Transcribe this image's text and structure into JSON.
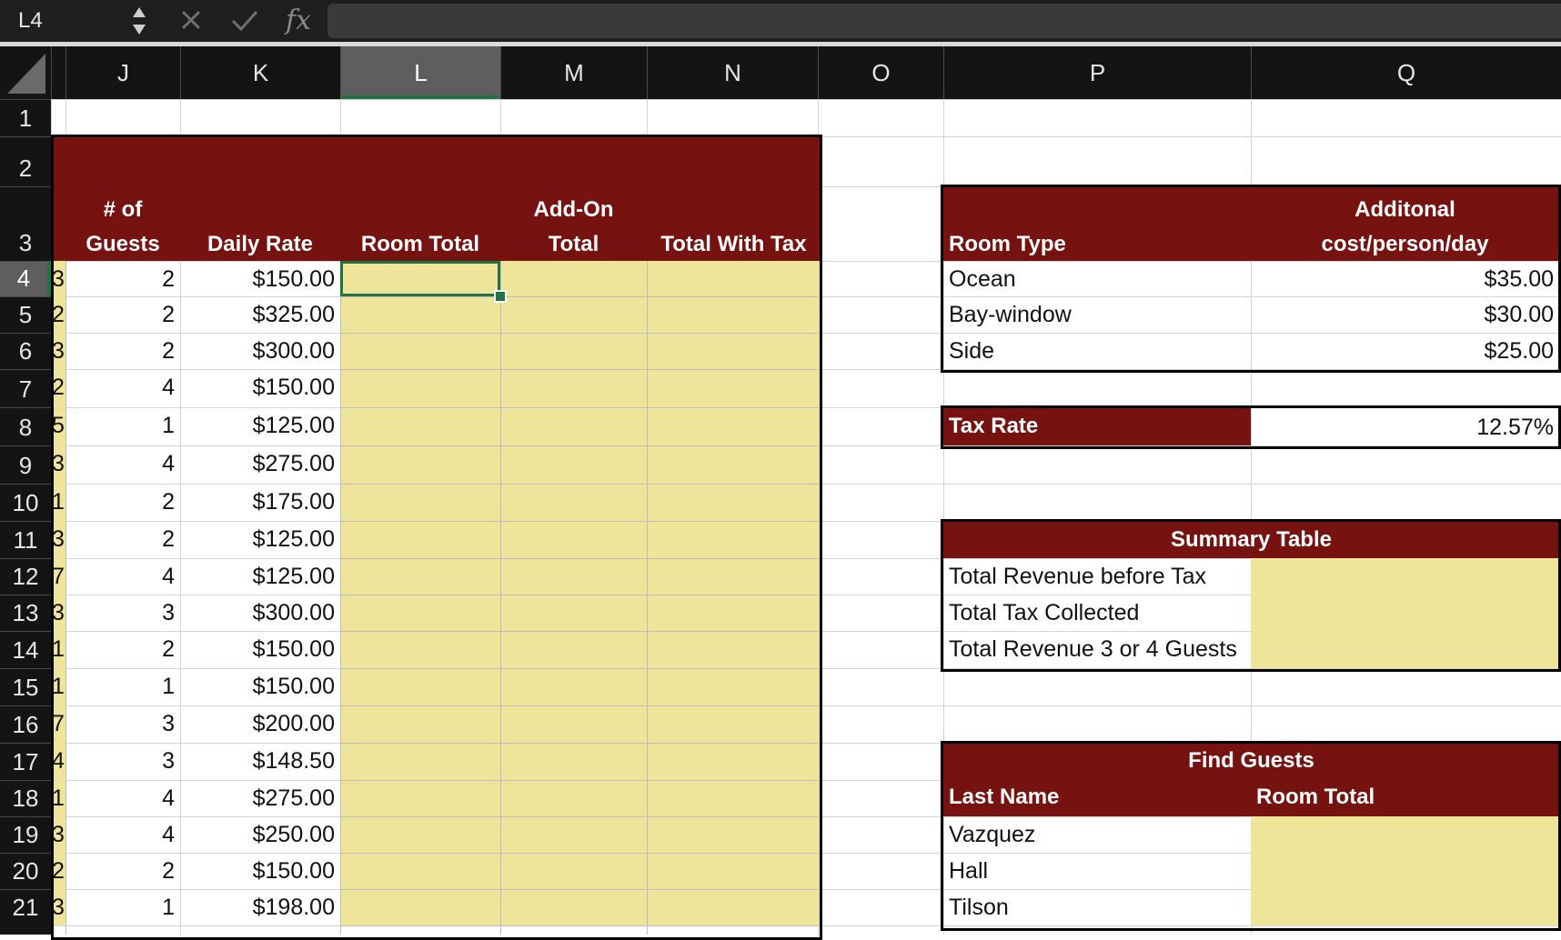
{
  "formula_bar": {
    "name_box": "L4",
    "formula": "",
    "cancel_icon": "close-icon",
    "enter_icon": "check-icon",
    "fx_label": "fx"
  },
  "columns": [
    "J",
    "K",
    "L",
    "M",
    "N",
    "O",
    "P",
    "Q"
  ],
  "rows": [
    "1",
    "2",
    "3",
    "4",
    "5",
    "6",
    "7",
    "8",
    "9",
    "10",
    "11",
    "12",
    "13",
    "14",
    "15",
    "16",
    "17",
    "18",
    "19",
    "20",
    "21"
  ],
  "selected_cell": {
    "column": "L",
    "row": "4"
  },
  "main_table": {
    "headers": {
      "guests_line1": "# of",
      "guests_line2": "Guests",
      "daily_rate": "Daily Rate",
      "room_total": "Room Total",
      "addon_line1": "Add-On",
      "addon_line2": "Total",
      "total_with_tax": "Total With Tax"
    },
    "partial_i": [
      "3",
      "2",
      "3",
      "2",
      "5",
      "3",
      "1",
      "3",
      "7",
      "3",
      "1",
      "1",
      "7",
      "4",
      "1",
      "3",
      "2",
      "3"
    ],
    "guests": [
      "2",
      "2",
      "2",
      "4",
      "1",
      "4",
      "2",
      "2",
      "4",
      "3",
      "2",
      "1",
      "3",
      "3",
      "4",
      "4",
      "2",
      "1"
    ],
    "daily_rate": [
      "$150.00",
      "$325.00",
      "$300.00",
      "$150.00",
      "$125.00",
      "$275.00",
      "$175.00",
      "$125.00",
      "$125.00",
      "$300.00",
      "$150.00",
      "$150.00",
      "$200.00",
      "$148.50",
      "$275.00",
      "$250.00",
      "$150.00",
      "$198.00"
    ]
  },
  "room_types": {
    "header_type": "Room Type",
    "header_cost_line1": "Additonal",
    "header_cost_line2": "cost/person/day",
    "items": [
      {
        "type": "Ocean",
        "cost": "$35.00"
      },
      {
        "type": "Bay-window",
        "cost": "$30.00"
      },
      {
        "type": "Side",
        "cost": "$25.00"
      }
    ]
  },
  "tax": {
    "label": "Tax Rate",
    "value": "12.57%"
  },
  "summary": {
    "title": "Summary Table",
    "items": [
      "Total Revenue before Tax",
      "Total Tax Collected",
      "Total Revenue 3 or 4 Guests"
    ]
  },
  "find_guests": {
    "title": "Find Guests",
    "header_last": "Last Name",
    "header_total": "Room Total",
    "items": [
      "Vazquez",
      "Hall",
      "Tilson"
    ]
  },
  "colors": {
    "maroon": "#76120f",
    "yellow": "#efe59a",
    "selection": "#217346"
  }
}
